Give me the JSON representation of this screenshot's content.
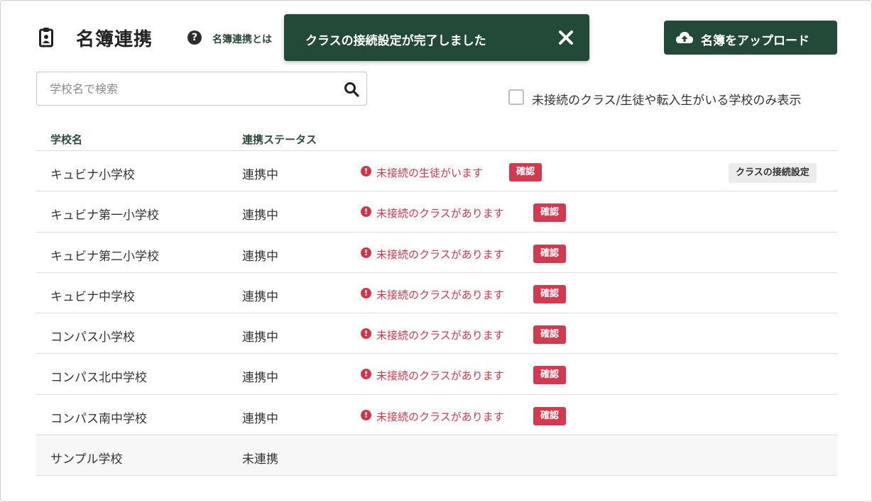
{
  "header": {
    "title": "名簿連携",
    "title_icon": "clipboard-user-icon",
    "help_icon": "question-circle-icon",
    "help_link": "名簿連携とは"
  },
  "toast": {
    "message": "クラスの接続設定が完了しました",
    "close_icon": "close-icon"
  },
  "upload_button": {
    "icon": "cloud-upload-icon",
    "label": "名簿をアップロード"
  },
  "search": {
    "placeholder": "学校名で検索",
    "value": "",
    "icon": "search-icon"
  },
  "filter": {
    "label": "未接続のクラス/生徒や転入生がいる学校のみ表示",
    "checked": false
  },
  "table": {
    "headers": {
      "name": "学校名",
      "status": "連携ステータス"
    },
    "confirm_label": "確認",
    "class_setting_label": "クラスの接続設定",
    "rows": [
      {
        "name": "キュビナ小学校",
        "status": "連携中",
        "alert": "未接続の生徒がいます"
      },
      {
        "name": "キュビナ第一小学校",
        "status": "連携中",
        "alert": "未接続のクラスがあります"
      },
      {
        "name": "キュビナ第二小学校",
        "status": "連携中",
        "alert": "未接続のクラスがあります"
      },
      {
        "name": "キュビナ中学校",
        "status": "連携中",
        "alert": "未接続のクラスがあります"
      },
      {
        "name": "コンパス小学校",
        "status": "連携中",
        "alert": "未接続のクラスがあります"
      },
      {
        "name": "コンパス北中学校",
        "status": "連携中",
        "alert": "未接続のクラスがあります"
      },
      {
        "name": "コンパス南中学校",
        "status": "連携中",
        "alert": "未接続のクラスがあります"
      },
      {
        "name": "サンプル学校",
        "status": "未連携",
        "alert": ""
      }
    ]
  },
  "colors": {
    "primary": "#234a38",
    "alert": "#c9394a",
    "confirm": "#d23b4f",
    "header_text": "#2d4a3e"
  }
}
